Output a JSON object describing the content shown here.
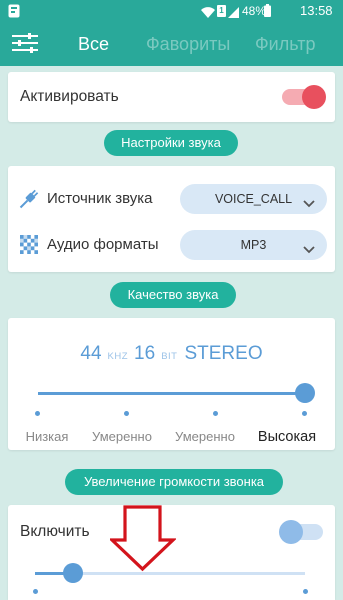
{
  "status_bar": {
    "sim_label": "1",
    "battery": "48%",
    "time": "13:58",
    "icons": [
      "app-notification-icon",
      "wifi-icon",
      "sim-icon",
      "signal-icon",
      "battery-icon"
    ]
  },
  "header": {
    "menu_icon": "sliders-icon",
    "tabs": [
      {
        "label": "Все",
        "active": true
      },
      {
        "label": "Фавориты",
        "active": false
      },
      {
        "label": "Фильтр",
        "active": false
      }
    ]
  },
  "activate": {
    "label": "Активировать",
    "enabled": true
  },
  "sound_settings": {
    "section_label": "Настройки звука",
    "source": {
      "icon": "plug-icon",
      "label": "Источник звука",
      "value": "VOICE_CALL",
      "dropdown_icon": "chevron-down-icon"
    },
    "format": {
      "icon": "audio-format-icon",
      "label": "Аудио форматы",
      "value": "MP3",
      "dropdown_icon": "chevron-down-icon"
    }
  },
  "quality": {
    "section_label": "Качество звука",
    "sample_rate": "44",
    "sample_rate_unit": "KHZ",
    "bit_depth": "16",
    "bit_depth_unit": "BIT",
    "channels": "STEREO",
    "levels": [
      "Низкая",
      "Умеренно",
      "Умеренно",
      "Высокая"
    ],
    "selected_index": 3,
    "slider_fraction": 1.0
  },
  "volume_boost": {
    "section_label": "Увеличение громкости звонка",
    "enable_label": "Включить",
    "enabled": false,
    "slider_fraction": 0.14
  },
  "annotation": {
    "icon": "red-down-arrow-icon"
  },
  "colors": {
    "primary": "#29a99a",
    "pill": "#22b29e",
    "background": "#d4ebe7",
    "accent_blue": "#5b9cd6",
    "toggle_on_thumb": "#e8505e",
    "toggle_on_track": "#f5abb2",
    "toggle_off_thumb": "#8fbbe8",
    "toggle_off_track": "#cfe1f4",
    "annotation_red": "#d3141c"
  }
}
